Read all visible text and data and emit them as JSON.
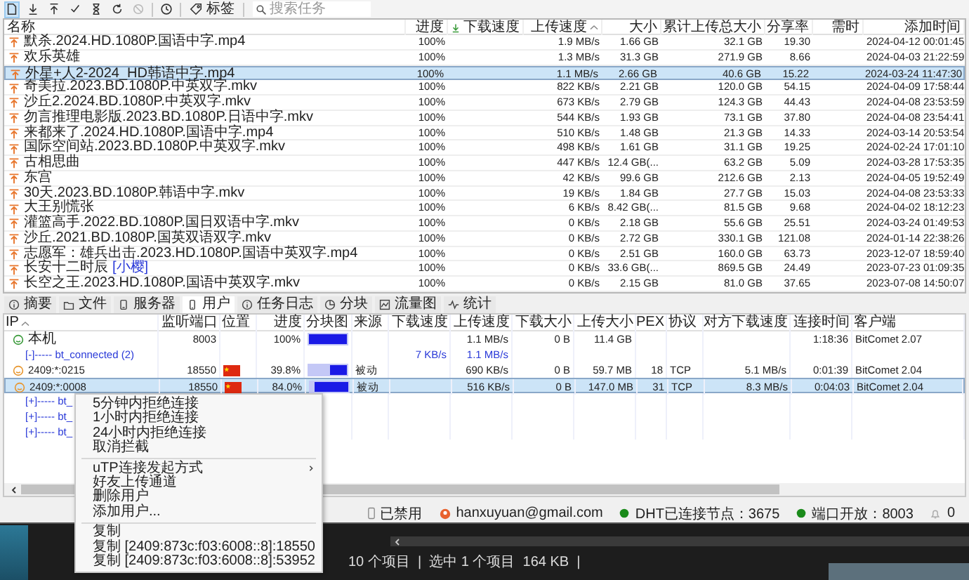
{
  "toolbar": {
    "buttons": [
      {
        "kind": "new",
        "selected": true,
        "disabled": false
      },
      {
        "kind": "download",
        "selected": false,
        "disabled": false
      },
      {
        "kind": "upload",
        "selected": false,
        "disabled": false
      },
      {
        "kind": "check",
        "selected": false,
        "disabled": false
      },
      {
        "kind": "hourglass",
        "selected": false,
        "disabled": false
      },
      {
        "kind": "refresh",
        "selected": false,
        "disabled": false
      },
      {
        "kind": "blocked",
        "selected": false,
        "disabled": true
      },
      {
        "kind": "history",
        "selected": false,
        "disabled": false
      }
    ],
    "tag_button": "标签",
    "search": {
      "placeholder": "搜索任务"
    }
  },
  "tasks": {
    "columns": [
      {
        "label": "名称",
        "sorted": false
      },
      {
        "label": "进度",
        "sorted": false
      },
      {
        "label": "下载速度",
        "sorted": false
      },
      {
        "label": "上传速度",
        "sorted": true
      },
      {
        "label": "大小",
        "sorted": false
      },
      {
        "label": "累计上传总大小",
        "sorted": false
      },
      {
        "label": "分享率",
        "sorted": false
      },
      {
        "label": "需时",
        "sorted": false
      },
      {
        "label": "添加时间",
        "sorted": false
      }
    ],
    "rows": [
      {
        "name": "默杀.2024.HD.1080P.国语中字.mp4",
        "progress": "100%",
        "upload": "1.9 MB/s",
        "size": "1.66 GB",
        "total_upload": "32.1 GB",
        "ratio": "19.30",
        "added": "2024-04-12 00:01:45",
        "selected": false
      },
      {
        "name": "欢乐英雄",
        "progress": "100%",
        "upload": "1.3 MB/s",
        "size": "31.3 GB",
        "total_upload": "271.9 GB",
        "ratio": "8.66",
        "added": "2024-04-03 21:22:59",
        "selected": false
      },
      {
        "name": "外星+人2-2024_HD韩语中字.mp4",
        "progress": "100%",
        "upload": "1.1 MB/s",
        "size": "2.66 GB",
        "total_upload": "40.6 GB",
        "ratio": "15.22",
        "added": "2024-03-24 11:47:30",
        "selected": true
      },
      {
        "name": "奇美拉.2023.BD.1080P.中英双字.mkv",
        "progress": "100%",
        "upload": "822 KB/s",
        "size": "2.21 GB",
        "total_upload": "120.0 GB",
        "ratio": "54.15",
        "added": "2024-04-09 17:58:44",
        "selected": false
      },
      {
        "name": "沙丘2.2024.BD.1080P.中英双字.mkv",
        "progress": "100%",
        "upload": "673 KB/s",
        "size": "2.79 GB",
        "total_upload": "124.3 GB",
        "ratio": "44.43",
        "added": "2024-04-08 23:53:59",
        "selected": false
      },
      {
        "name": "勿言推理电影版.2023.BD.1080P.日语中字.mkv",
        "progress": "100%",
        "upload": "544 KB/s",
        "size": "1.93 GB",
        "total_upload": "73.1 GB",
        "ratio": "37.80",
        "added": "2024-04-08 23:54:41",
        "selected": false
      },
      {
        "name": "来都来了.2024.HD.1080P.国语中字.mp4",
        "progress": "100%",
        "upload": "510 KB/s",
        "size": "1.48 GB",
        "total_upload": "21.3 GB",
        "ratio": "14.33",
        "added": "2024-03-14 20:53:54",
        "selected": false
      },
      {
        "name": "国际空间站.2023.BD.1080P.中英双字.mkv",
        "progress": "100%",
        "upload": "498 KB/s",
        "size": "1.61 GB",
        "total_upload": "31.1 GB",
        "ratio": "19.25",
        "added": "2024-02-24 17:01:10",
        "selected": false
      },
      {
        "name": "古相思曲",
        "progress": "100%",
        "upload": "447 KB/s",
        "size": "12.4 GB(...",
        "total_upload": "63.2 GB",
        "ratio": "5.09",
        "added": "2024-03-28 17:53:35",
        "selected": false
      },
      {
        "name": "东宫",
        "progress": "100%",
        "upload": "42 KB/s",
        "size": "99.6 GB",
        "total_upload": "212.6 GB",
        "ratio": "2.13",
        "added": "2024-04-05 19:52:49",
        "selected": false
      },
      {
        "name": "30天.2023.BD.1080P.韩语中字.mkv",
        "progress": "100%",
        "upload": "19 KB/s",
        "size": "1.84 GB",
        "total_upload": "27.7 GB",
        "ratio": "15.03",
        "added": "2024-04-08 23:53:33",
        "selected": false
      },
      {
        "name": "大王别慌张",
        "progress": "100%",
        "upload": "6 KB/s",
        "size": "8.42 GB(...",
        "total_upload": "81.5 GB",
        "ratio": "9.68",
        "added": "2024-04-02 18:12:23",
        "selected": false
      },
      {
        "name": "灌篮高手.2022.BD.1080P.国日双语中字.mkv",
        "progress": "100%",
        "upload": "0 KB/s",
        "size": "2.18 GB",
        "total_upload": "55.6 GB",
        "ratio": "25.51",
        "added": "2024-03-24 01:49:53",
        "selected": false
      },
      {
        "name": "沙丘.2021.BD.1080P.国英双语双字.mkv",
        "progress": "100%",
        "upload": "0 KB/s",
        "size": "2.72 GB",
        "total_upload": "330.1 GB",
        "ratio": "121.08",
        "added": "2024-01-14 22:38:26",
        "selected": false
      },
      {
        "name": "志愿军：雄兵出击.2023.HD.1080P.国语中英双字.mp4",
        "progress": "100%",
        "upload": "0 KB/s",
        "size": "2.51 GB",
        "total_upload": "160.0 GB",
        "ratio": "63.73",
        "added": "2023-12-07 18:59:40",
        "selected": false
      },
      {
        "name": "长安十二时辰",
        "tag": "[小樱]",
        "progress": "100%",
        "upload": "0 KB/s",
        "size": "33.6 GB(...",
        "total_upload": "869.5 GB",
        "ratio": "24.49",
        "added": "2023-07-23 01:09:35",
        "selected": false
      },
      {
        "name": "长空之王.2023.HD.1080P.国语中英双字.mkv",
        "progress": "100%",
        "upload": "0 KB/s",
        "size": "2.15 GB",
        "total_upload": "81.0 GB",
        "ratio": "37.65",
        "added": "2023-07-08 14:50:07",
        "selected": false
      }
    ]
  },
  "detail_tabs": [
    {
      "label": "摘要",
      "selected": false
    },
    {
      "label": "文件",
      "selected": false
    },
    {
      "label": "服务器",
      "selected": false
    },
    {
      "label": "用户",
      "selected": true
    },
    {
      "label": "任务日志",
      "selected": false
    },
    {
      "label": "分块",
      "selected": false
    },
    {
      "label": "流量图",
      "selected": false
    },
    {
      "label": "统计",
      "selected": false
    }
  ],
  "peers": {
    "columns": [
      {
        "label": "IP",
        "sorted": true
      },
      {
        "label": "监听端口",
        "sorted": false
      },
      {
        "label": "位置",
        "sorted": false
      },
      {
        "label": "进度",
        "sorted": false
      },
      {
        "label": "分块图",
        "sorted": false
      },
      {
        "label": "来源",
        "sorted": false
      },
      {
        "label": "下载速度",
        "sorted": false
      },
      {
        "label": "上传速度",
        "sorted": false
      },
      {
        "label": "下载大小",
        "sorted": false
      },
      {
        "label": "上传大小",
        "sorted": false
      },
      {
        "label": "PEX",
        "sorted": false
      },
      {
        "label": "协议",
        "sorted": false
      },
      {
        "label": "对方下载速度",
        "sorted": false
      },
      {
        "label": "连接时间",
        "sorted": false
      },
      {
        "label": "客户端",
        "sorted": false
      }
    ],
    "rows": [
      {
        "kind": "local",
        "ip": "本机",
        "port": "8003",
        "progress": "100%",
        "level": 1,
        "upload_speed": "1.1 MB/s",
        "downloaded": "0 B",
        "uploaded": "11.4 GB",
        "connected": "1:18:36",
        "client": "BitComet 2.07",
        "selected": false
      },
      {
        "kind": "group",
        "ip": "[-]----- bt_connected (2)",
        "download_speed": "7 KB/s",
        "upload_speed": "1.1 MB/s",
        "selected": false
      },
      {
        "kind": "peer",
        "ip": "2409:*:0215",
        "port": "18550",
        "progress": "39.8%",
        "level": 0.398,
        "source": "被动",
        "upload_speed": "690 KB/s",
        "downloaded": "0 B",
        "uploaded": "59.7 MB",
        "pex": "18",
        "protocol": "TCP",
        "remote_speed": "5.1 MB/s",
        "connected": "0:01:39",
        "client": "BitComet 2.04",
        "selected": false
      },
      {
        "kind": "peer",
        "ip": "2409:*:0008",
        "port": "18550",
        "progress": "84.0%",
        "level": 0.84,
        "source": "被动",
        "upload_speed": "516 KB/s",
        "downloaded": "0 B",
        "uploaded": "147.0 MB",
        "pex": "31",
        "protocol": "TCP",
        "remote_speed": "8.3 MB/s",
        "connected": "0:04:03",
        "client": "BitComet 2.04",
        "selected": true
      },
      {
        "kind": "group",
        "ip": "[+]----- bt_",
        "selected": false
      },
      {
        "kind": "group",
        "ip": "[+]----- bt_",
        "selected": false
      },
      {
        "kind": "group",
        "ip": "[+]----- bt_",
        "selected": false
      }
    ]
  },
  "context_menu": {
    "groups": [
      [
        {
          "label": "5分钟内拒绝连接",
          "submenu": false
        },
        {
          "label": "1小时内拒绝连接",
          "submenu": false
        },
        {
          "label": "24小时内拒绝连接",
          "submenu": false
        },
        {
          "label": "取消拦截",
          "submenu": false
        }
      ],
      [
        {
          "label": "uTP连接发起方式",
          "submenu": true
        },
        {
          "label": "好友上传通道",
          "submenu": false
        },
        {
          "label": "删除用户",
          "submenu": false
        },
        {
          "label": "添加用户...",
          "submenu": false
        }
      ],
      [
        {
          "label": "复制",
          "submenu": false
        },
        {
          "label": "复制 [2409:873c:f03:6008::8]:18550",
          "submenu": false
        },
        {
          "label": "复制 [2409:873c:f03:6008::8]:53952",
          "submenu": false
        }
      ]
    ]
  },
  "status_bar": [
    {
      "kind": "toggle",
      "label": "已禁用"
    },
    {
      "kind": "user",
      "label": "hanxuyuan@gmail.com"
    },
    {
      "kind": "dot",
      "label": "DHT已连接节点：3675"
    },
    {
      "kind": "dot",
      "label": "端口开放：8003"
    },
    {
      "kind": "bell",
      "label": "0"
    }
  ],
  "background_window": {
    "status": "10 个项目  |  选中 1 个项目  164 KB  |"
  }
}
